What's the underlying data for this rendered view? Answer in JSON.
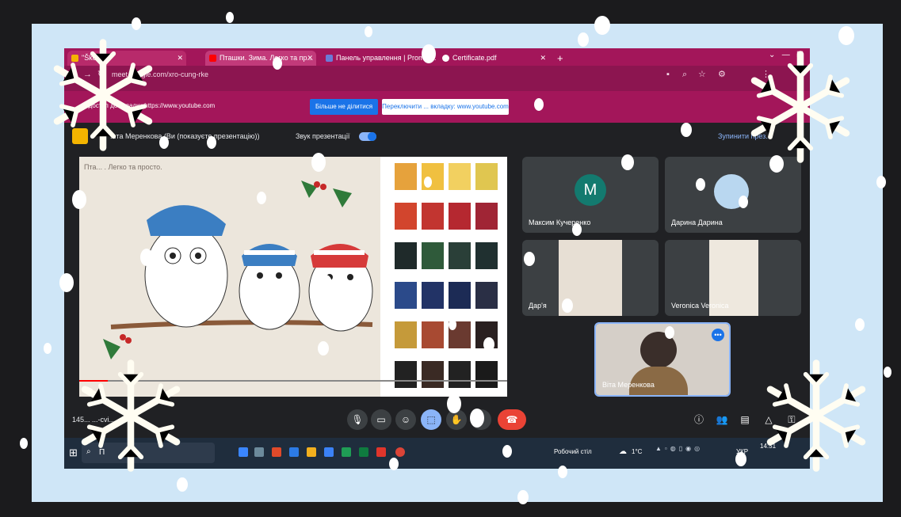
{
  "browser": {
    "tabs": [
      {
        "label": "\"Ško-..."
      },
      {
        "label": "Пташки. Зима. Легко та пр..."
      },
      {
        "label": "Панель управлення | Prometh..."
      },
      {
        "label": "Certificate.pdf"
      }
    ],
    "new_tab_label": "+",
    "url": "meet.google.com/xro-cung-rke"
  },
  "share_bar": {
    "text": "...доступ до вкладки https://www.youtube.com",
    "stop_label": "Більше не ділитися",
    "switch_label": "Переключити ... вкладку: www.youtube.com"
  },
  "presenter_bar": {
    "presenter_text": "...та Меренкова (Ви (показуєте презентацію))",
    "sound_label": "Звук презентації",
    "stop_label": "Зупинити през..."
  },
  "presentation": {
    "video_title": "Пта... . Легко та просто."
  },
  "participants": [
    {
      "name": "Максим Кучеренко",
      "initial": "M"
    },
    {
      "name": "Дарина Дарина"
    },
    {
      "name": "Дар'я"
    },
    {
      "name": "Veronica Veronica"
    },
    {
      "name": "Віта Меренкова"
    }
  ],
  "meeting_code": "145... ...-cvi...",
  "taskbar": {
    "search_label": "П",
    "desktop_label": "Робочий стіл",
    "weather": "1°C",
    "lang": "УКР",
    "time": "14:51"
  },
  "colors": {
    "tab_bar": "#a3165a",
    "frame": "#cfe6f7",
    "end_call": "#ea4335",
    "accent": "#1a73e8"
  }
}
